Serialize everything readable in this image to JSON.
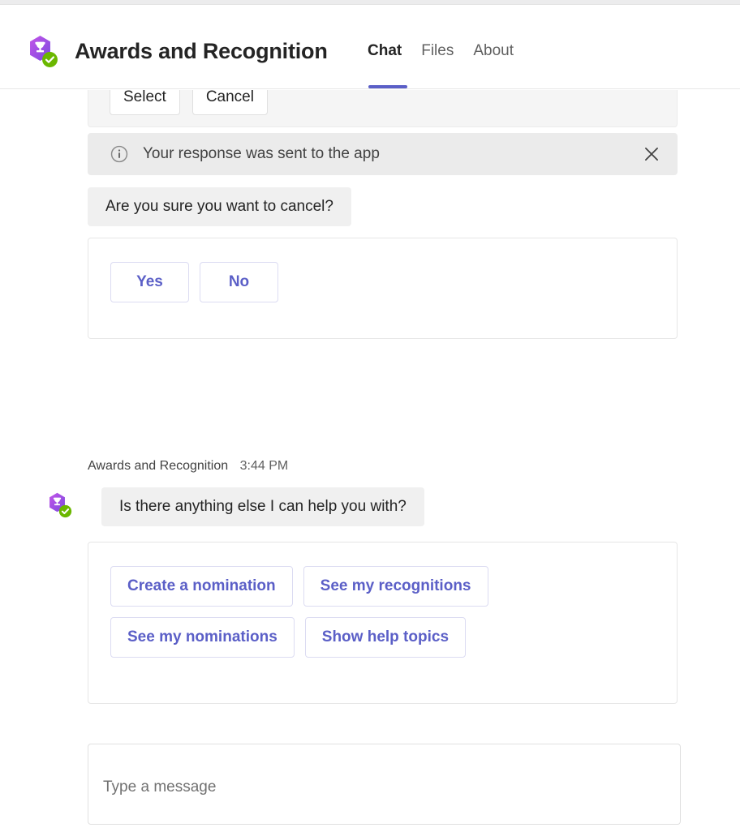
{
  "header": {
    "app_title": "Awards and Recognition",
    "app_icon": "trophy-hexagon-icon",
    "presence": "available-check-icon",
    "tabs": [
      {
        "label": "Chat",
        "active": true
      },
      {
        "label": "Files",
        "active": false
      },
      {
        "label": "About",
        "active": false
      }
    ],
    "accent_color": "#5b5fc7"
  },
  "chat": {
    "cut_off_card": {
      "buttons": [
        {
          "label": "Select"
        },
        {
          "label": "Cancel"
        }
      ]
    },
    "notification": {
      "icon": "info-circle-icon",
      "text": "Your response was sent to the app",
      "close_icon": "close-icon",
      "background": "#ebebeb"
    },
    "confirm_message": {
      "text": "Are you sure you want to cancel?"
    },
    "confirm_card": {
      "buttons": [
        {
          "label": "Yes"
        },
        {
          "label": "No"
        }
      ]
    },
    "bot_message": {
      "sender": "Awards and Recognition",
      "timestamp": "3:44 PM",
      "avatar": "trophy-hexagon-icon",
      "presence": "available-check-icon",
      "text": "Is there anything else I can help you with?"
    },
    "suggested_actions": {
      "buttons": [
        {
          "label": "Create a nomination"
        },
        {
          "label": "See my recognitions"
        },
        {
          "label": "See my nominations"
        },
        {
          "label": "Show help topics"
        }
      ]
    }
  },
  "compose": {
    "placeholder": "Type a message",
    "value": ""
  }
}
